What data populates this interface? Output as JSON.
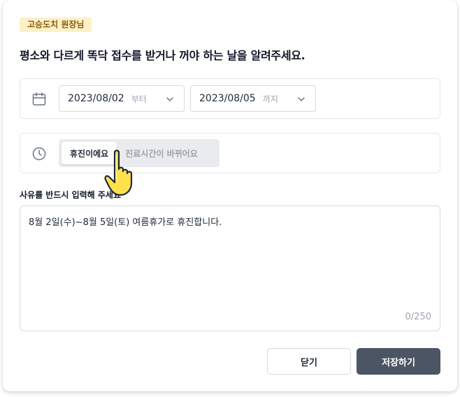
{
  "badge": "고승도치 원장님",
  "heading": "평소와 다르게 똑닥 접수를 받거나 꺼야 하는 날을 알려주세요.",
  "date_range": {
    "from": {
      "value": "2023/08/02",
      "suffix": "부터"
    },
    "to": {
      "value": "2023/08/05",
      "suffix": "까지"
    }
  },
  "type_toggle": {
    "options": [
      "휴진이에요",
      "진료시간이 바뀌어요"
    ],
    "selected": "휴진이에요"
  },
  "reason": {
    "label": "사유를 반드시 입력해 주세요",
    "value": "8월 2일(수)~8월 5일(토) 여름휴가로 휴진합니다.",
    "counter": "0/250"
  },
  "buttons": {
    "close": "닫기",
    "save": "저장하기"
  },
  "icons": {
    "calendar": "calendar-icon",
    "clock": "clock-icon",
    "chevron": "chevron-down-icon",
    "cursor": "pointer-hand-icon"
  },
  "colors": {
    "badge_bg": "#fdf1c7",
    "badge_text": "#8a5a06",
    "primary_button": "#4b5563"
  }
}
